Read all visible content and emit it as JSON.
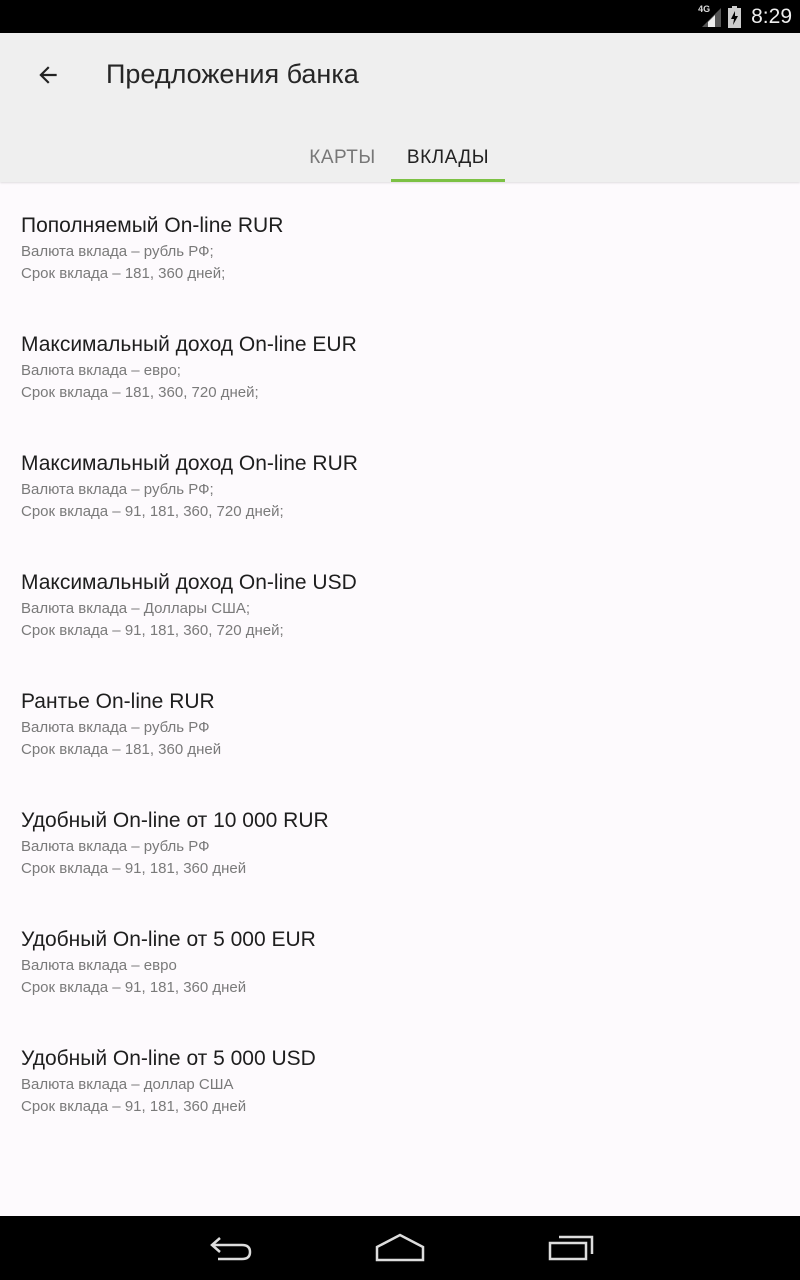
{
  "status_bar": {
    "network": "4G",
    "time": "8:29",
    "icons": [
      "signal-icon",
      "battery-icon"
    ]
  },
  "app_bar": {
    "title": "Предложения банка",
    "back_icon": "arrow-back-icon"
  },
  "tabs": [
    {
      "label": "КАРТЫ",
      "selected": false
    },
    {
      "label": "ВКЛАДЫ",
      "selected": true
    }
  ],
  "colors": {
    "accent": "#7cc144",
    "app_bar_bg": "#efefef",
    "page_bg": "#fdfafd"
  },
  "deposits": [
    {
      "title": "Пополняемый On-line RUR",
      "line1": "Валюта вклада – рубль РФ;",
      "line2": "Срок вклада – 181, 360 дней;"
    },
    {
      "title": "Максимальный доход On-line EUR",
      "line1": "Валюта вклада – евро;",
      "line2": "Срок вклада – 181, 360, 720 дней;"
    },
    {
      "title": "Максимальный доход On-line RUR",
      "line1": "Валюта вклада – рубль РФ;",
      "line2": "Срок вклада – 91, 181, 360, 720 дней;"
    },
    {
      "title": "Максимальный доход On-line USD",
      "line1": "Валюта вклада – Доллары США;",
      "line2": "Срок вклада – 91, 181, 360, 720 дней;"
    },
    {
      "title": "Рантье On-line RUR",
      "line1": "Валюта вклада – рубль РФ",
      "line2": "Срок вклада – 181, 360 дней"
    },
    {
      "title": "Удобный On-line от 10 000 RUR",
      "line1": "Валюта вклада – рубль РФ",
      "line2": "Срок вклада – 91, 181, 360 дней"
    },
    {
      "title": "Удобный On-line от 5 000 EUR",
      "line1": "Валюта вклада – евро",
      "line2": "Срок вклада – 91, 181, 360 дней"
    },
    {
      "title": "Удобный On-line от 5 000 USD",
      "line1": "Валюта вклада – доллар США",
      "line2": "Срок вклада – 91, 181, 360 дней"
    }
  ],
  "nav_bar": {
    "buttons": [
      "back-nav-icon",
      "home-nav-icon",
      "recents-nav-icon"
    ]
  }
}
